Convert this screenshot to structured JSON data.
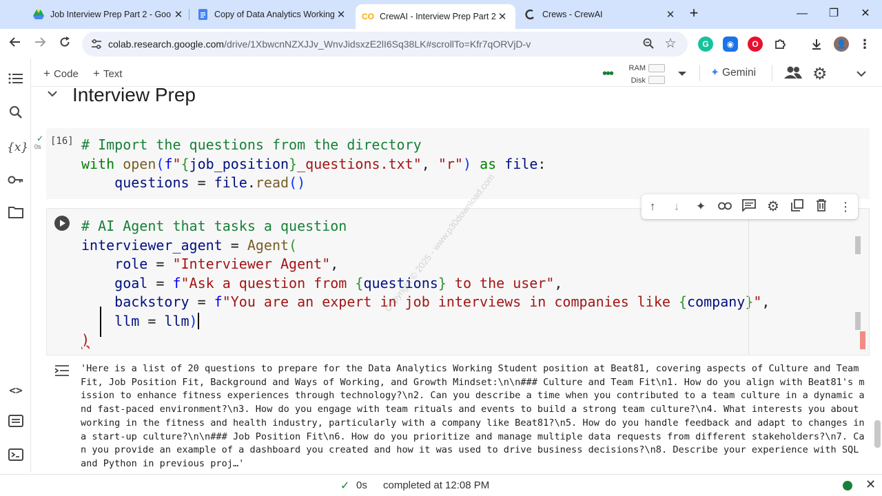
{
  "browser": {
    "tabs": [
      {
        "title": "Job Interview Prep Part 2 - Goo",
        "icon": "google-drive-icon"
      },
      {
        "title": "Copy of Data Analytics Working",
        "icon": "google-docs-icon"
      },
      {
        "title": "CrewAI - Interview Prep Part 2.i",
        "icon": "colab-icon"
      },
      {
        "title": "Crews - CrewAI",
        "icon": "crewai-icon"
      }
    ],
    "url_host": "colab.research.google.com",
    "url_path": "/drive/1XbwcnNZXJJv_WnvJidsxzE2lI6Sq38LK#scrollTo=Kfr7qORVjD-v"
  },
  "colab": {
    "toolbar": {
      "code_label": "Code",
      "text_label": "Text",
      "ram_label": "RAM",
      "disk_label": "Disk",
      "gemini_label": "Gemini"
    },
    "section_title": "Interview Prep",
    "cell1": {
      "exec_count": "[16]",
      "exec_time": "0s"
    },
    "status": {
      "time": "0s",
      "completed": "completed at 12:08 PM"
    }
  },
  "output_text": "'Here is a list of 20 questions to prepare for the Data Analytics Working Student position at Beat81, covering aspects of Culture and Team Fit, Job Position Fit, Background and Ways of Working, and Growth Mindset:\\n\\n### Culture and Team Fit\\n1. How do you align with Beat81's mission to enhance fitness experiences through technology?\\n2. Can you describe a time when you contributed to a team culture in a dynamic and fast-paced environment?\\n3. How do you engage with team rituals and events to build a strong team culture?\\n4. What interests you about working in the fitness and health industry, particularly with a company like Beat81?\\n5. How do you handle feedback and adapt to changes in a start-up culture?\\n\\n### Job Position Fit\\n6. How do you prioritize and manage multiple data requests from different stakeholders?\\n7. Can you provide an example of a dashboard you created and how it was used to drive business decisions?\\n8. Describe your experience with SQL and Python in previous proj…'",
  "watermark": "Copyright © 2025 - www.p30download.com",
  "colors": {
    "tabbar": "#d3e3fd",
    "comment": "#188038",
    "string": "#a31515",
    "keyword": "#0000ff"
  }
}
